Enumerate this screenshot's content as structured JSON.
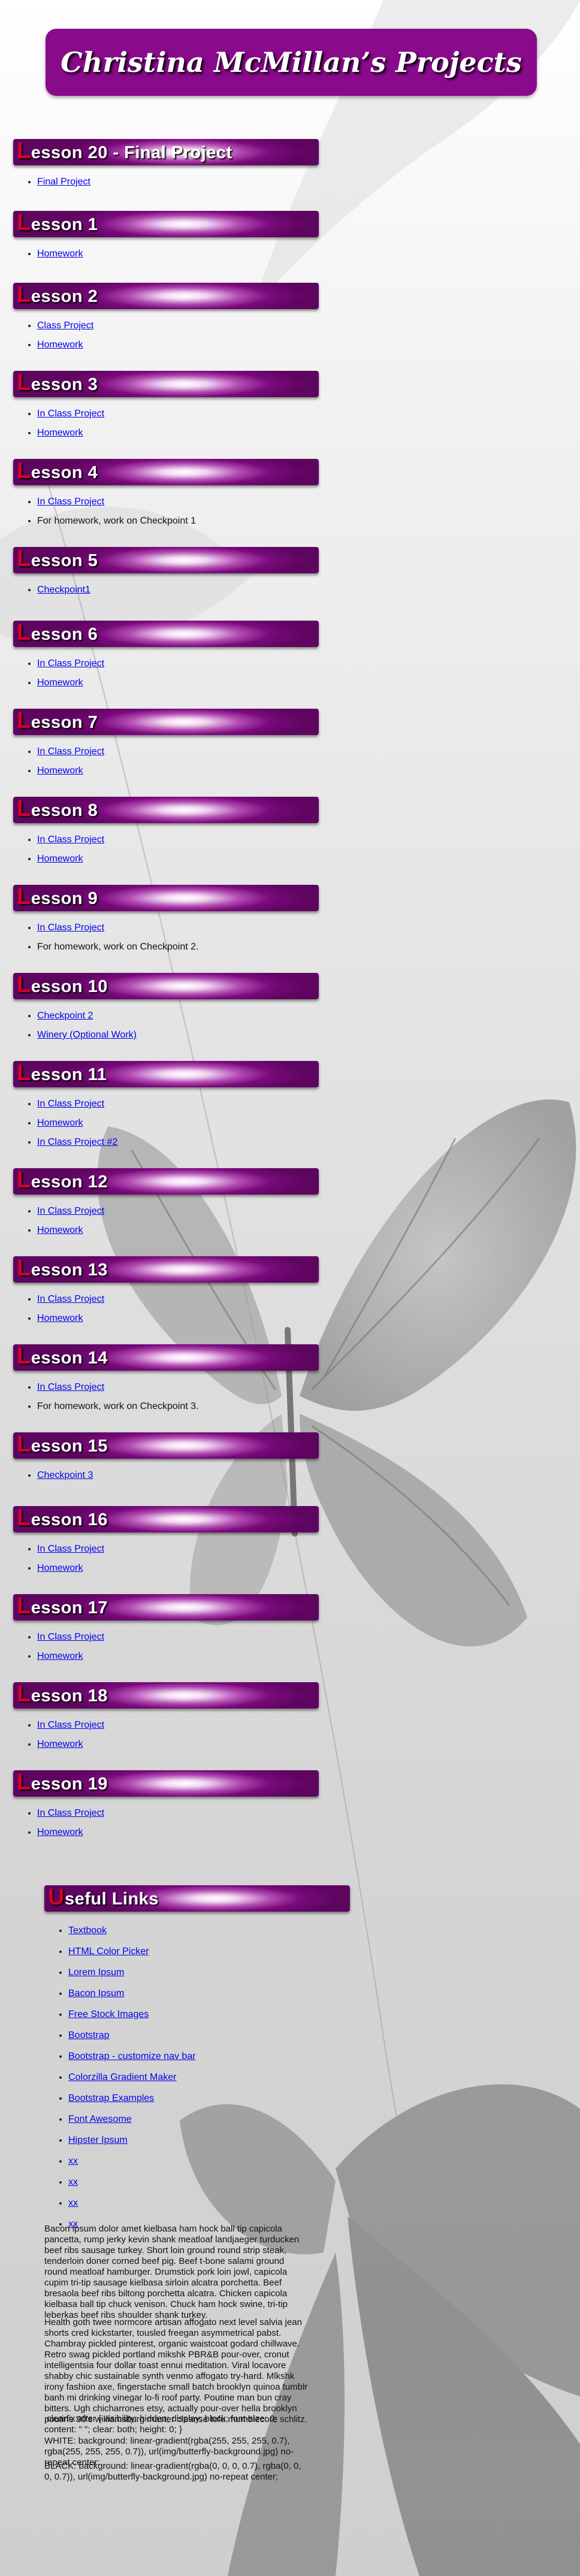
{
  "page_title": "Christina McMillan’s Projects",
  "lessons": [
    {
      "label": "Lesson 20 - Final Project",
      "items": [
        {
          "text": "Final Project",
          "link": true
        }
      ]
    },
    {
      "label": "Lesson 1",
      "items": [
        {
          "text": "Homework",
          "link": true
        }
      ]
    },
    {
      "label": "Lesson 2",
      "items": [
        {
          "text": "Class Project",
          "link": true
        },
        {
          "text": "Homework",
          "link": true
        }
      ]
    },
    {
      "label": "Lesson 3",
      "items": [
        {
          "text": "In Class Project",
          "link": true
        },
        {
          "text": "Homework",
          "link": true
        }
      ]
    },
    {
      "label": "Lesson 4",
      "items": [
        {
          "text": "In Class Project",
          "link": true
        },
        {
          "text": "For homework, work on Checkpoint 1",
          "link": false
        }
      ]
    },
    {
      "label": "Lesson 5",
      "items": [
        {
          "text": "Checkpoint1",
          "link": true
        }
      ]
    },
    {
      "label": "Lesson 6",
      "items": [
        {
          "text": "In Class Project",
          "link": true
        },
        {
          "text": "Homework",
          "link": true
        }
      ]
    },
    {
      "label": "Lesson 7",
      "items": [
        {
          "text": "In Class Project",
          "link": true
        },
        {
          "text": "Homework",
          "link": true
        }
      ]
    },
    {
      "label": "Lesson 8",
      "items": [
        {
          "text": "In Class Project",
          "link": true
        },
        {
          "text": "Homework",
          "link": true
        }
      ]
    },
    {
      "label": "Lesson 9",
      "items": [
        {
          "text": "In Class Project",
          "link": true
        },
        {
          "text": "For homework, work on Checkpoint 2.",
          "link": false
        }
      ]
    },
    {
      "label": "Lesson 10",
      "items": [
        {
          "text": "Checkpoint 2",
          "link": true
        },
        {
          "text": "Winery (Optional Work)",
          "link": true
        }
      ]
    },
    {
      "label": "Lesson 11",
      "items": [
        {
          "text": "In Class Project",
          "link": true
        },
        {
          "text": "Homework",
          "link": true
        },
        {
          "text": "In Class Project #2",
          "link": true
        }
      ]
    },
    {
      "label": "Lesson 12",
      "items": [
        {
          "text": "In Class Project",
          "link": true
        },
        {
          "text": "Homework",
          "link": true
        }
      ]
    },
    {
      "label": "Lesson 13",
      "items": [
        {
          "text": "In Class Project",
          "link": true
        },
        {
          "text": "Homework",
          "link": true
        }
      ]
    },
    {
      "label": "Lesson 14",
      "items": [
        {
          "text": "In Class Project",
          "link": true
        },
        {
          "text": "For homework, work on Checkpoint 3.",
          "link": false
        }
      ]
    },
    {
      "label": "Lesson 15",
      "items": [
        {
          "text": "Checkpoint 3",
          "link": true
        }
      ]
    },
    {
      "label": "Lesson 16",
      "items": [
        {
          "text": "In Class Project",
          "link": true
        },
        {
          "text": "Homework",
          "link": true
        }
      ]
    },
    {
      "label": "Lesson 17",
      "items": [
        {
          "text": "In Class Project",
          "link": true
        },
        {
          "text": "Homework",
          "link": true
        }
      ]
    },
    {
      "label": "Lesson 18",
      "items": [
        {
          "text": "In Class Project",
          "link": true
        },
        {
          "text": "Homework",
          "link": true
        }
      ]
    },
    {
      "label": "Lesson 19",
      "items": [
        {
          "text": "In Class Project",
          "link": true
        },
        {
          "text": "Homework",
          "link": true
        }
      ]
    }
  ],
  "useful_links": {
    "label": "Useful Links",
    "items": [
      "Textbook",
      "HTML Color Picker",
      "Lorem Ipsum",
      "Bacon Ipsum",
      "Free Stock Images",
      "Bootstrap",
      "Bootstrap - customize nav bar",
      "Colorzilla Gradient Maker",
      "Bootstrap Examples",
      "Font Awesome",
      "Hipster Ipsum",
      "xx",
      "xx",
      "xx",
      "xx"
    ]
  },
  "paragraphs": [
    "Bacon ipsum dolor amet kielbasa ham hock ball tip capicola pancetta, rump jerky kevin shank meatloaf landjaeger turducken beef ribs sausage turkey. Short loin ground round strip steak, tenderloin doner corned beef pig. Beef t-bone salami ground round meatloaf hamburger. Drumstick pork loin jowl, capicola cupim tri-tip sausage kielbasa sirloin alcatra porchetta. Beef bresaola beef ribs biltong porchetta alcatra. Chicken capicola kielbasa ball tip chuck venison. Chuck ham hock swine, tri-tip leberkas beef ribs shoulder shank turkey.",
    "Health goth twee normcore artisan affogato next level salvia jean shorts cred kickstarter, tousled freegan asymmetrical pabst. Chambray pickled pinterest, organic waistcoat godard chillwave. Retro swag pickled portland mikshk PBR&B pour-over, cronut intelligentsia four dollar toast ennui meditation. Viral locavore shabby chic sustainable synth venmo affogato try-hard. Mlkshk irony fashion axe, fingerstache small batch brooklyn quinoa tumblr banh mi drinking vinegar lo-fi roof party. Poutine man bun cray bitters. Ugh chicharrones etsy, actually pour-over hella brooklyn poutine 90's williamsburg master cleanse tofu mumblecore schlitz.",
    ".clearfix:after { visibility: hidden; display: block; font-size: 0; content: \" \"; clear: both; height: 0; }",
    "WHITE: background: linear-gradient(rgba(255, 255, 255, 0.7), rgba(255, 255, 255, 0.7)), url(img/butterfly-background.jpg) no-repeat center;",
    "BLACK: background: linear-gradient(rgba(0, 0, 0, 0.7), rgba(0, 0, 0, 0.7)), url(img/butterfly-background.jpg) no-repeat center;"
  ]
}
